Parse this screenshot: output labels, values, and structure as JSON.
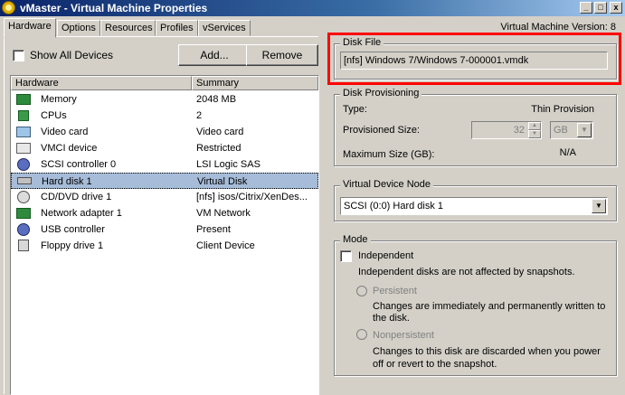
{
  "window": {
    "title": "vMaster - Virtual Machine Properties",
    "minimize": "_",
    "maximize": "□",
    "close": "x"
  },
  "tabs": [
    {
      "label": "Hardware",
      "active": true
    },
    {
      "label": "Options"
    },
    {
      "label": "Resources"
    },
    {
      "label": "Profiles"
    },
    {
      "label": "vServices"
    }
  ],
  "vm_version": "Virtual Machine Version: 8",
  "left": {
    "show_all_label": "Show All Devices",
    "add_label": "Add...",
    "remove_label": "Remove",
    "columns": [
      "Hardware",
      "Summary"
    ],
    "rows": [
      {
        "name": "Memory",
        "summary": "2048 MB",
        "icon": "memory-icon"
      },
      {
        "name": "CPUs",
        "summary": "2",
        "icon": "cpu-icon"
      },
      {
        "name": "Video card",
        "summary": "Video card",
        "icon": "monitor-icon"
      },
      {
        "name": "VMCI device",
        "summary": "Restricted",
        "icon": "vmci-icon"
      },
      {
        "name": "SCSI controller 0",
        "summary": "LSI Logic SAS",
        "icon": "scsi-icon"
      },
      {
        "name": "Hard disk 1",
        "summary": "Virtual Disk",
        "icon": "hard-disk-icon",
        "selected": true
      },
      {
        "name": "CD/DVD drive 1",
        "summary": "[nfs] isos/Citrix/XenDes...",
        "icon": "cd-icon"
      },
      {
        "name": "Network adapter 1",
        "summary": "VM Network",
        "icon": "network-icon"
      },
      {
        "name": "USB controller",
        "summary": "Present",
        "icon": "usb-icon"
      },
      {
        "name": "Floppy drive 1",
        "summary": "Client Device",
        "icon": "floppy-icon"
      }
    ]
  },
  "disk_file": {
    "title": "Disk File",
    "value": "[nfs] Windows 7/Windows 7-000001.vmdk"
  },
  "provisioning": {
    "title": "Disk Provisioning",
    "type_label": "Type:",
    "type_value": "Thin Provision",
    "provisioned_label": "Provisioned Size:",
    "provisioned_value": "32",
    "unit": "GB",
    "max_label": "Maximum Size (GB):",
    "max_value": "N/A"
  },
  "vdn": {
    "title": "Virtual Device Node",
    "value": "SCSI (0:0) Hard disk 1"
  },
  "mode": {
    "title": "Mode",
    "independent_label": "Independent",
    "independent_desc": "Independent disks are not affected by snapshots.",
    "persistent_label": "Persistent",
    "persistent_desc1": "Changes are immediately and permanently written to",
    "persistent_desc2": "the disk.",
    "nonpersistent_label": "Nonpersistent",
    "nonpersistent_desc1": "Changes to this disk are discarded when you power",
    "nonpersistent_desc2": "off or revert to the snapshot."
  },
  "colors": {
    "highlight": "#ff0000",
    "selection": "#a6bcd8",
    "titlebar": "#0a246a"
  }
}
